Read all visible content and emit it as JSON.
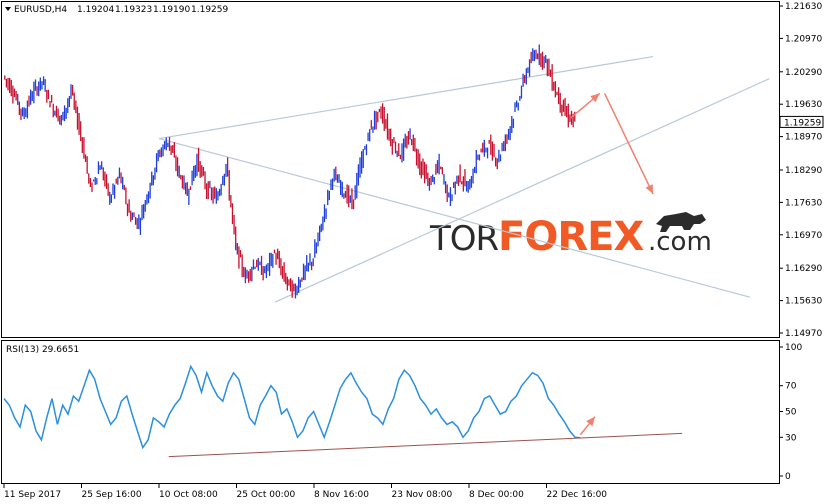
{
  "chart_data": [
    {
      "type": "candlestick",
      "symbol": "EURUSD,H4",
      "ohlc": {
        "open": "1.19204",
        "high": "1.19323",
        "low": "1.19190",
        "close": "1.19259"
      },
      "current_price_label": "1.19259",
      "y_ticks": [
        "1.21630",
        "1.20970",
        "1.20290",
        "1.19630",
        "1.18970",
        "1.18290",
        "1.17630",
        "1.16970",
        "1.16290",
        "1.15630",
        "1.14970"
      ],
      "ylim": [
        1.1497,
        1.2163
      ],
      "x_ticks": [
        "11 Sep 2017",
        "25 Sep 16:00",
        "10 Oct 08:00",
        "25 Oct 00:00",
        "8 Nov 16:00",
        "23 Nov 08:00",
        "8 Dec 00:00",
        "22 Dec 16:00"
      ],
      "price_path": [
        {
          "t": 0,
          "v": 1.202
        },
        {
          "t": 2,
          "v": 1.199
        },
        {
          "t": 4,
          "v": 1.194
        },
        {
          "t": 6,
          "v": 1.1985
        },
        {
          "t": 8,
          "v": 1.201
        },
        {
          "t": 10,
          "v": 1.196
        },
        {
          "t": 12,
          "v": 1.193
        },
        {
          "t": 14,
          "v": 1.199
        },
        {
          "t": 16,
          "v": 1.19
        },
        {
          "t": 18,
          "v": 1.179
        },
        {
          "t": 20,
          "v": 1.184
        },
        {
          "t": 22,
          "v": 1.177
        },
        {
          "t": 24,
          "v": 1.182
        },
        {
          "t": 26,
          "v": 1.174
        },
        {
          "t": 28,
          "v": 1.172
        },
        {
          "t": 30,
          "v": 1.179
        },
        {
          "t": 32,
          "v": 1.186
        },
        {
          "t": 34,
          "v": 1.189
        },
        {
          "t": 36,
          "v": 1.183
        },
        {
          "t": 38,
          "v": 1.178
        },
        {
          "t": 40,
          "v": 1.185
        },
        {
          "t": 42,
          "v": 1.179
        },
        {
          "t": 44,
          "v": 1.177
        },
        {
          "t": 46,
          "v": 1.184
        },
        {
          "t": 48,
          "v": 1.167
        },
        {
          "t": 50,
          "v": 1.161
        },
        {
          "t": 52,
          "v": 1.164
        },
        {
          "t": 54,
          "v": 1.162
        },
        {
          "t": 56,
          "v": 1.166
        },
        {
          "t": 58,
          "v": 1.161
        },
        {
          "t": 60,
          "v": 1.158
        },
        {
          "t": 62,
          "v": 1.162
        },
        {
          "t": 64,
          "v": 1.165
        },
        {
          "t": 66,
          "v": 1.173
        },
        {
          "t": 68,
          "v": 1.182
        },
        {
          "t": 70,
          "v": 1.179
        },
        {
          "t": 72,
          "v": 1.176
        },
        {
          "t": 74,
          "v": 1.185
        },
        {
          "t": 76,
          "v": 1.192
        },
        {
          "t": 78,
          "v": 1.195
        },
        {
          "t": 80,
          "v": 1.189
        },
        {
          "t": 82,
          "v": 1.186
        },
        {
          "t": 84,
          "v": 1.19
        },
        {
          "t": 86,
          "v": 1.184
        },
        {
          "t": 88,
          "v": 1.18
        },
        {
          "t": 90,
          "v": 1.184
        },
        {
          "t": 92,
          "v": 1.177
        },
        {
          "t": 94,
          "v": 1.182
        },
        {
          "t": 96,
          "v": 1.179
        },
        {
          "t": 98,
          "v": 1.186
        },
        {
          "t": 100,
          "v": 1.188
        },
        {
          "t": 102,
          "v": 1.185
        },
        {
          "t": 104,
          "v": 1.19
        },
        {
          "t": 106,
          "v": 1.196
        },
        {
          "t": 108,
          "v": 1.203
        },
        {
          "t": 110,
          "v": 1.207
        },
        {
          "t": 112,
          "v": 1.205
        },
        {
          "t": 114,
          "v": 1.199
        },
        {
          "t": 116,
          "v": 1.1945
        },
        {
          "t": 118,
          "v": 1.1926
        }
      ],
      "trendlines": [
        {
          "name": "upper-channel",
          "from": {
            "t": 32,
            "v": 1.1893
          },
          "to": {
            "t": 134,
            "v": 1.206
          }
        },
        {
          "name": "upper-descending",
          "from": {
            "t": 32,
            "v": 1.1893
          },
          "to": {
            "t": 154,
            "v": 1.157
          }
        },
        {
          "name": "lower-ascending",
          "from": {
            "t": 56,
            "v": 1.156
          },
          "to": {
            "t": 158,
            "v": 1.2015
          }
        }
      ],
      "arrows": [
        {
          "name": "up-arrow",
          "from": {
            "t": 117,
            "v": 1.1935
          },
          "to": {
            "t": 123,
            "v": 1.1985
          }
        },
        {
          "name": "down-arrow",
          "from": {
            "t": 124,
            "v": 1.1985
          },
          "to": {
            "t": 134,
            "v": 1.178
          }
        }
      ],
      "watermark": {
        "tor": "TOR",
        "forex": "FOREX",
        "com": ".com"
      }
    },
    {
      "type": "line",
      "title": "RSI(13) 29.6651",
      "y_ticks": [
        "100",
        "70",
        "50",
        "30",
        "0"
      ],
      "ylim": [
        0,
        100
      ],
      "values": [
        60,
        55,
        45,
        38,
        55,
        50,
        35,
        28,
        45,
        60,
        40,
        55,
        48,
        62,
        58,
        70,
        82,
        75,
        60,
        50,
        40,
        45,
        58,
        62,
        48,
        35,
        22,
        28,
        45,
        42,
        38,
        48,
        55,
        60,
        72,
        85,
        78,
        65,
        80,
        70,
        62,
        58,
        72,
        80,
        75,
        60,
        45,
        40,
        55,
        62,
        70,
        65,
        48,
        52,
        42,
        30,
        35,
        45,
        50,
        40,
        30,
        42,
        55,
        68,
        75,
        80,
        72,
        65,
        60,
        48,
        45,
        40,
        52,
        60,
        75,
        82,
        78,
        70,
        60,
        55,
        48,
        52,
        45,
        40,
        42,
        38,
        30,
        35,
        45,
        50,
        60,
        62,
        55,
        48,
        50,
        58,
        62,
        70,
        75,
        80,
        78,
        72,
        60,
        55,
        48,
        42,
        35,
        30,
        29.7
      ],
      "support_line": {
        "from": {
          "t": 34,
          "v": 15
        },
        "to": {
          "t": 140,
          "v": 33
        }
      },
      "arrow": {
        "from": {
          "t": 119,
          "v": 32
        },
        "to": {
          "t": 122,
          "v": 46
        }
      }
    }
  ]
}
